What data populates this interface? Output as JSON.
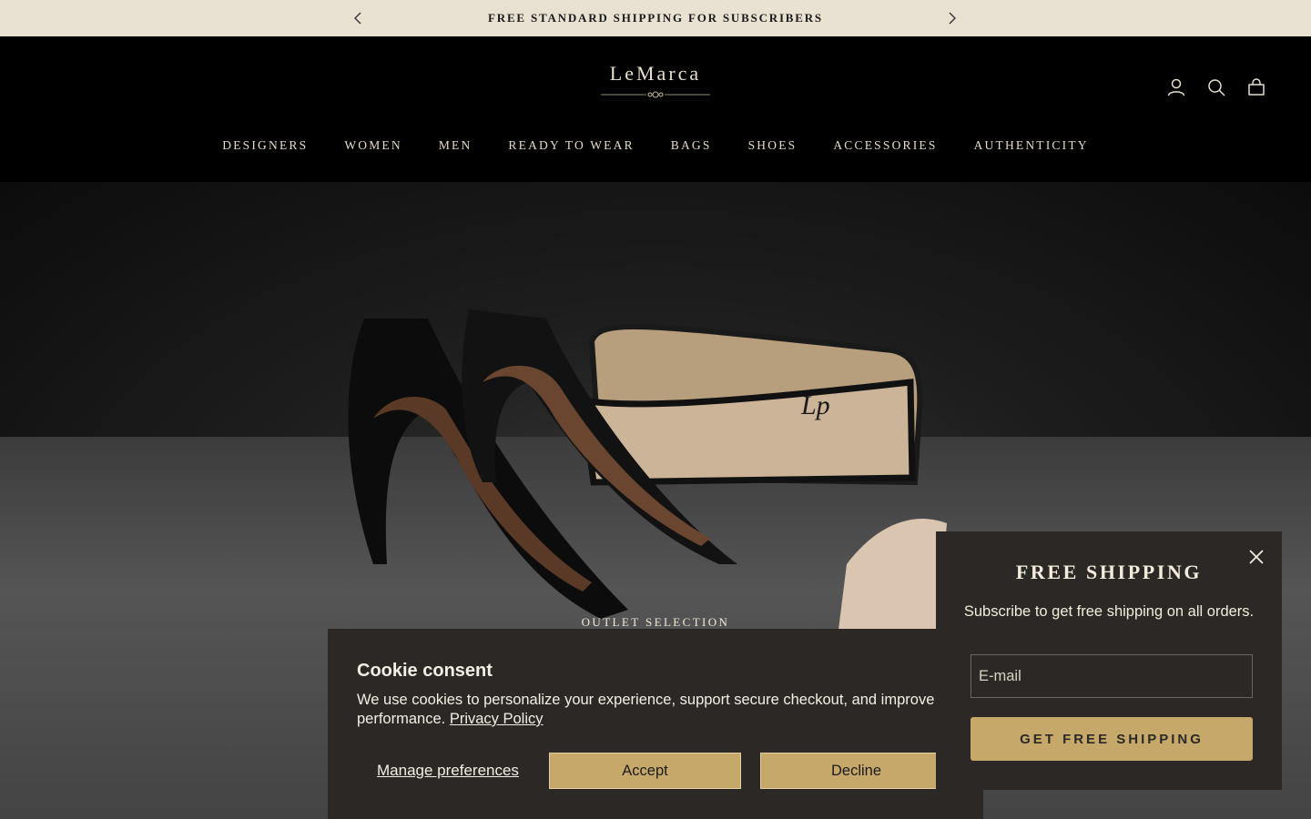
{
  "announcement": {
    "text": "FREE STANDARD SHIPPING FOR SUBSCRIBERS",
    "prev_icon": "chevron-left-icon",
    "next_icon": "chevron-right-icon"
  },
  "header": {
    "logo": "LeMarca",
    "icons": [
      "account-icon",
      "search-icon",
      "cart-icon"
    ],
    "nav": [
      "DESIGNERS",
      "WOMEN",
      "MEN",
      "READY TO WEAR",
      "BAGS",
      "SHOES",
      "ACCESSORIES",
      "AUTHENTICITY"
    ]
  },
  "hero": {
    "eyebrow": "OUTLET SELECTION"
  },
  "cookie": {
    "title": "Cookie consent",
    "body": "We use cookies to personalize your experience, support secure checkout, and improve site performance.",
    "link": "Privacy Policy",
    "manage": "Manage preferences",
    "accept": "Accept",
    "decline": "Decline"
  },
  "popup": {
    "title": "FREE SHIPPING",
    "subtitle": "Subscribe to get free shipping on all orders.",
    "email_placeholder": "E-mail",
    "button": "GET FREE SHIPPING"
  },
  "colors": {
    "announce_bg": "#e9e2d3",
    "header_bg": "#000000",
    "panel_bg": "#2b2825",
    "gold": "#c7a86b",
    "cream_text": "#f4efe4"
  }
}
